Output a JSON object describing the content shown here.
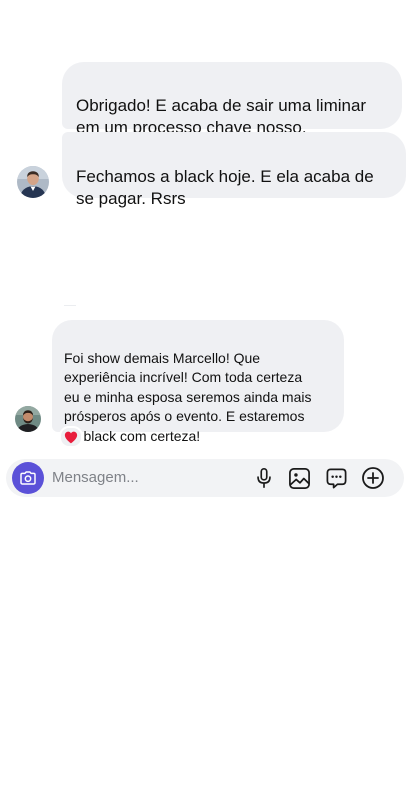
{
  "conversation": {
    "messages": [
      {
        "text": "Obrigado! E acaba de sair uma liminar\nem um processo chave nosso."
      },
      {
        "text": "Fechamos a black hoje. E ela acaba de\nse pagar. Rsrs"
      },
      {
        "text": "Foi show demais Marcello! Que\nexperiência incrível! Com toda certeza\neu e minha esposa seremos ainda mais\nprósperos após o evento. E estaremos\nna black com certeza!",
        "reaction": "❤️"
      }
    ]
  },
  "composer": {
    "placeholder": "Mensagem...",
    "icons": [
      "camera-icon",
      "microphone-icon",
      "gallery-icon",
      "sticker-icon",
      "add-icon"
    ],
    "accent_color": "#5b51d8"
  }
}
